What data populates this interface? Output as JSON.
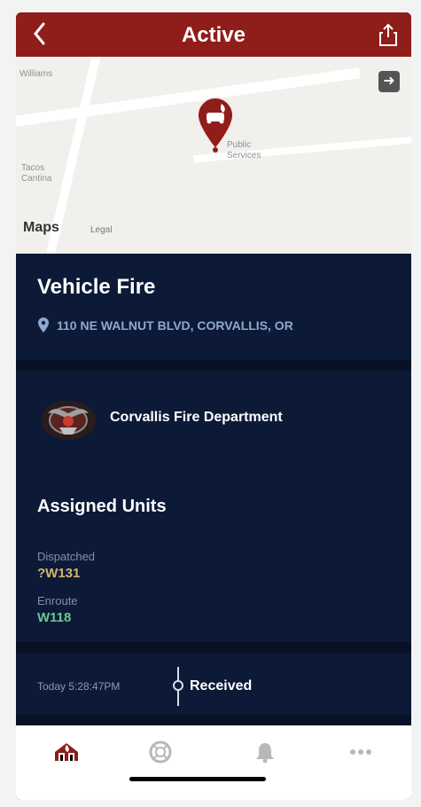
{
  "header": {
    "title": "Active",
    "back_icon": "chevron-left-icon",
    "share_icon": "share-icon"
  },
  "map": {
    "labels": [
      "Williams",
      "Tacos",
      "Cantina",
      "Public",
      "Services"
    ],
    "logo_text": "Maps",
    "legal_text": "Legal",
    "nav_icon": "directions-icon",
    "pin_icon": "vehicle-fire-icon"
  },
  "incident": {
    "title": "Vehicle Fire",
    "address": "110 NE WALNUT BLVD, CORVALLIS, OR",
    "location_icon": "location-pin-icon"
  },
  "department": {
    "name": "Corvallis Fire Department",
    "logo_icon": "department-badge-icon"
  },
  "units": {
    "title": "Assigned Units",
    "dispatched": {
      "label": "Dispatched",
      "value": "?W131",
      "color": "#d6b567"
    },
    "enroute": {
      "label": "Enroute",
      "value": "W118",
      "color": "#69c98f"
    }
  },
  "timeline": {
    "time": "Today 5:28:47PM",
    "event": "Received"
  },
  "tabbar": {
    "items": [
      "house-fire-icon",
      "life-ring-icon",
      "bell-icon",
      "more-icon"
    ],
    "active_color": "#8f1d1a",
    "inactive_color": "#b8b8b8"
  }
}
